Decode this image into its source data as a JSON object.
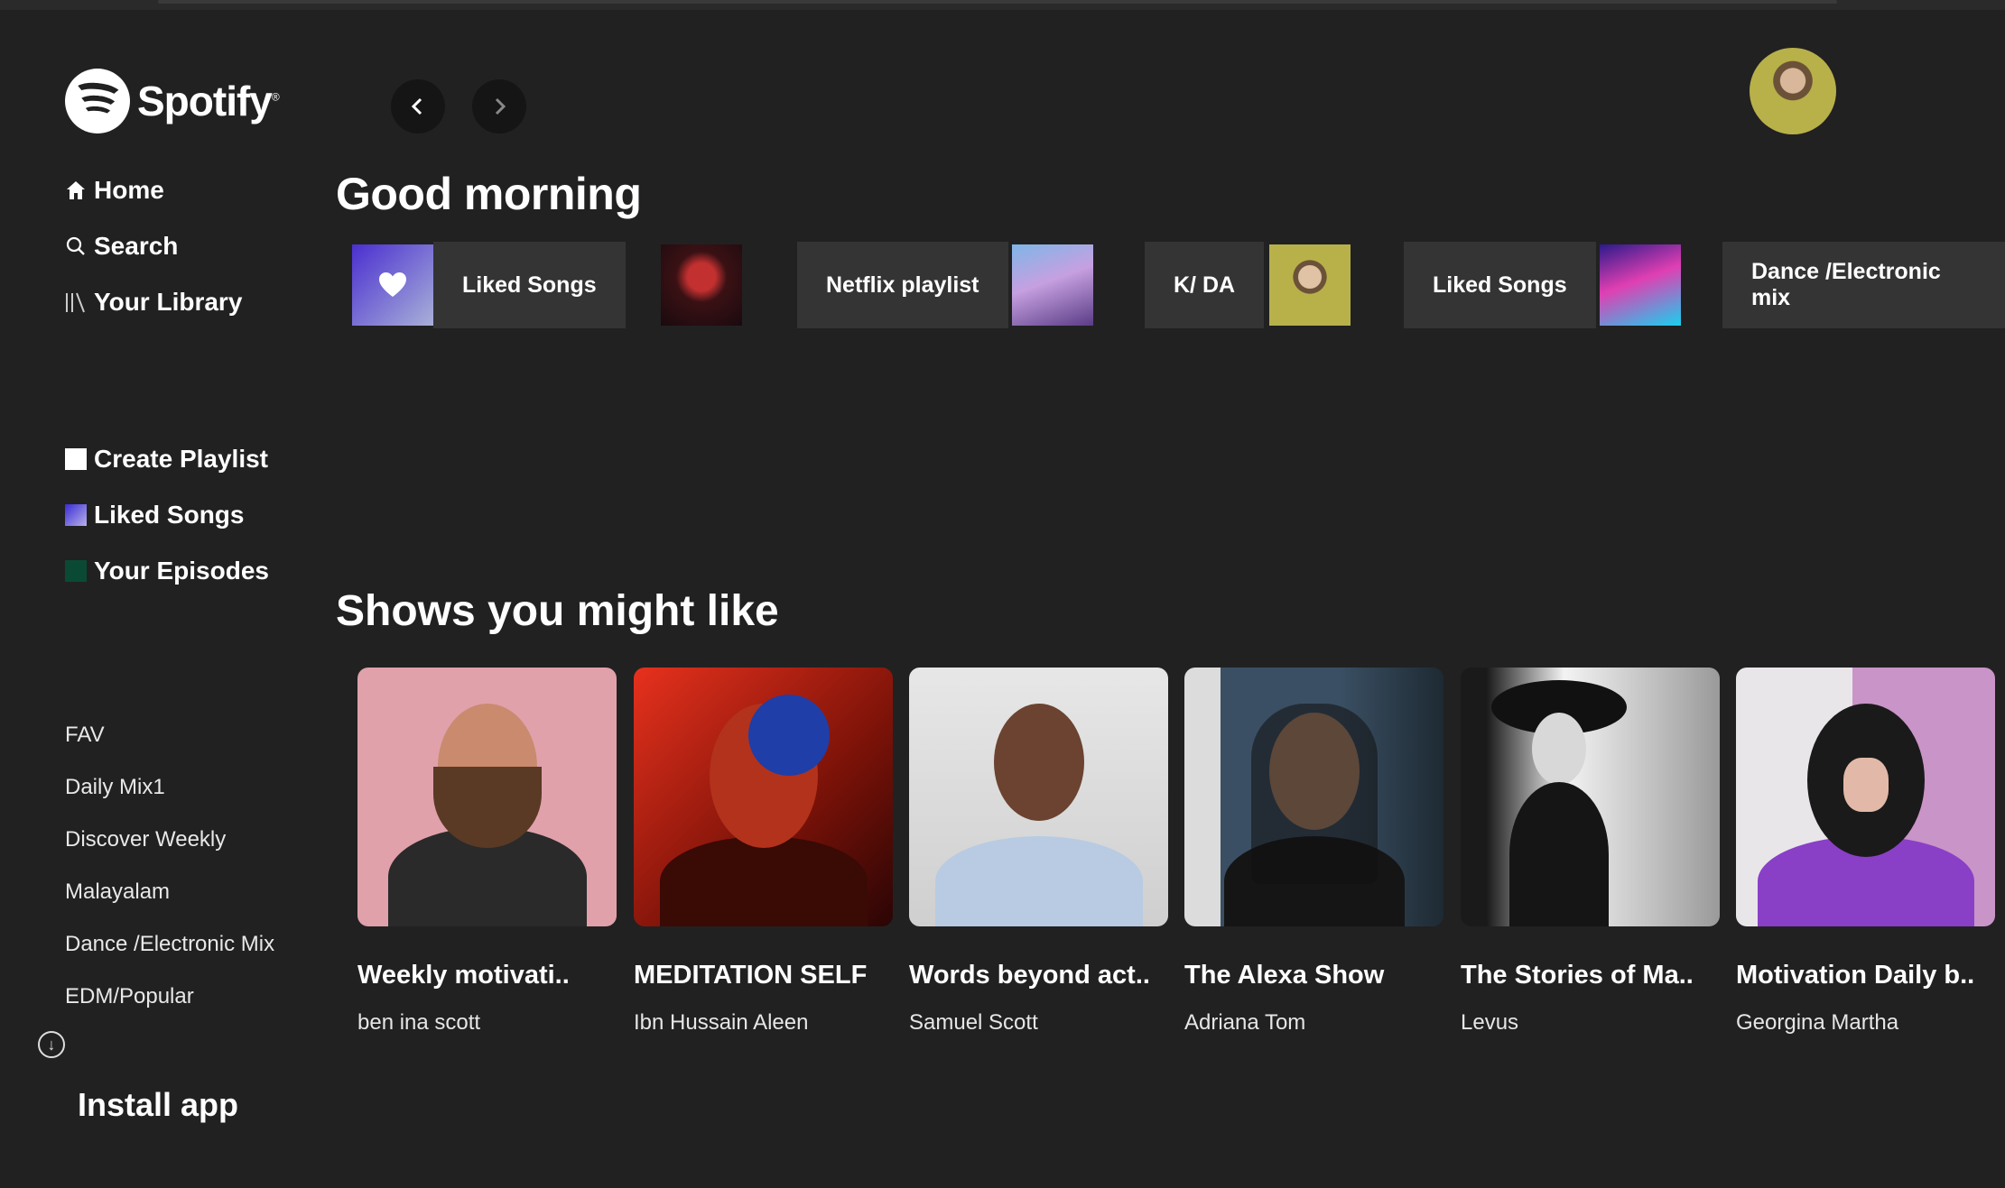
{
  "brand": {
    "name": "Spotify"
  },
  "sidebar": {
    "nav": [
      {
        "label": "Home",
        "icon": "home-icon"
      },
      {
        "label": "Search",
        "icon": "search-icon"
      },
      {
        "label": "Your Library",
        "icon": "library-icon"
      }
    ],
    "actions": [
      {
        "label": "Create Playlist"
      },
      {
        "label": "Liked Songs"
      },
      {
        "label": "Your Episodes"
      }
    ],
    "playlists": [
      "FAV",
      "Daily Mix1",
      "Discover Weekly",
      "Malayalam",
      "Dance /Electronic Mix",
      "EDM/Popular"
    ],
    "install_label": "Install app"
  },
  "greeting": "Good morning",
  "quick_picks": [
    {
      "label": "Liked Songs"
    },
    {
      "label": ""
    },
    {
      "label": "Netflix playlist"
    },
    {
      "label": "K/ DA"
    },
    {
      "label": "Liked Songs"
    },
    {
      "label": "Dance /Electronic mix"
    }
  ],
  "shows_title": "Shows you might like",
  "shows": [
    {
      "title": "Weekly motivati..",
      "author": "ben ina scott"
    },
    {
      "title": "MEDITATION SELF",
      "author": "Ibn Hussain Aleen"
    },
    {
      "title": "Words beyond act..",
      "author": "Samuel Scott"
    },
    {
      "title": "The Alexa Show",
      "author": "Adriana Tom"
    },
    {
      "title": "The Stories of Ma..",
      "author": "Levus"
    },
    {
      "title": "Motivation Daily b..",
      "author": "Georgina Martha"
    }
  ],
  "colors": {
    "background": "#212122",
    "tile": "#343435",
    "accent_liked": "#4a2fd0",
    "episodes": "#0a4a35"
  }
}
